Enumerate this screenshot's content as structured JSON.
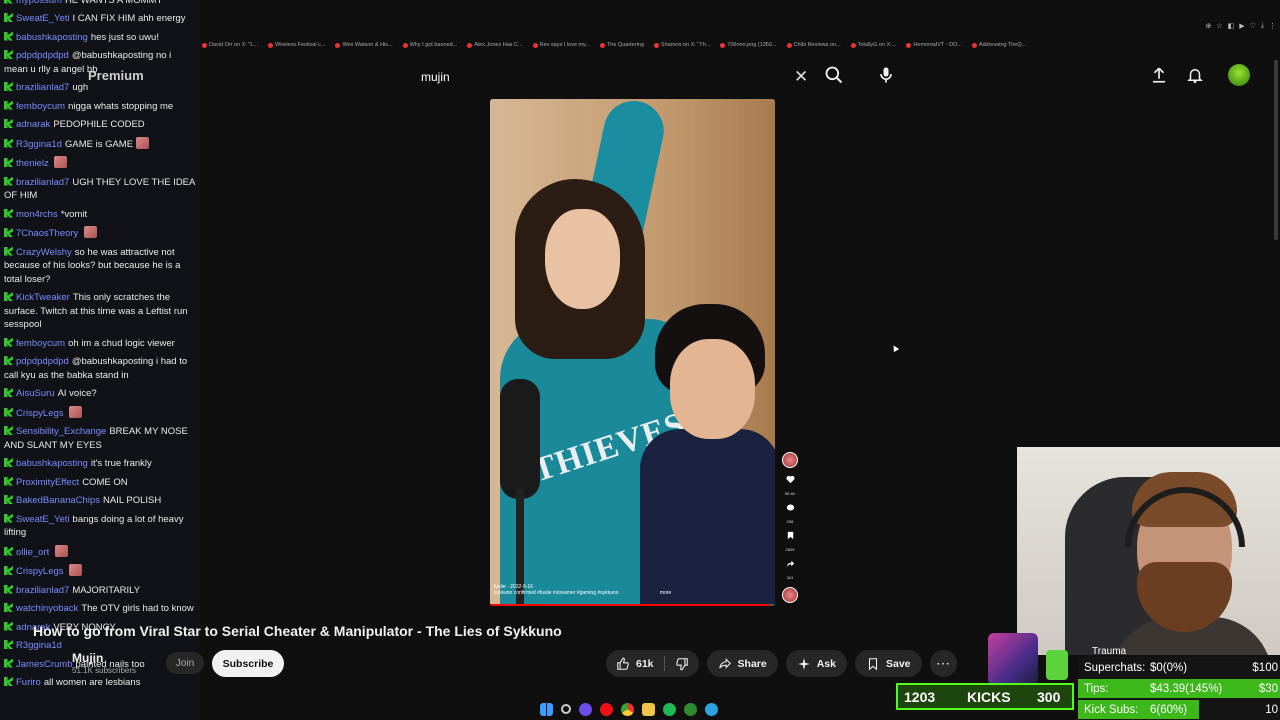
{
  "chat": {
    "messages": [
      {
        "user": "mypossum",
        "text": "HE WANTS A MOMMY"
      },
      {
        "user": "SweatE_Yeti",
        "text": "I CAN FIX HIM ahh energy"
      },
      {
        "user": "babushkaposting",
        "text": "hes just so uwu!"
      },
      {
        "user": "pdpdpdpdpd",
        "text": "@babushkaposting no i mean u rlly a angel bb"
      },
      {
        "user": "brazilianlad7",
        "text": "ugh"
      },
      {
        "user": "femboycum",
        "text": "nigga whats stopping me"
      },
      {
        "user": "adnarak",
        "text": "PEDOPHILE CODED"
      },
      {
        "user": "R3ggina1d",
        "text": "GAME is GAME",
        "emote": true
      },
      {
        "user": "thenielz",
        "text": "",
        "emote": true
      },
      {
        "user": "brazilianlad7",
        "text": "UGH THEY LOVE THE IDEA OF HIM"
      },
      {
        "user": "mon4rchs",
        "text": "*vomit"
      },
      {
        "user": "7ChaosTheory",
        "text": "",
        "emote": true
      },
      {
        "user": "CrazyWelshy",
        "text": "so he was attractive not because of his looks? but because he is a total loser?"
      },
      {
        "user": "KickTweaker",
        "text": "This only scratches the surface. Twitch at this time was a Leftist run sesspool"
      },
      {
        "user": "femboycum",
        "text": "oh im a chud logic viewer"
      },
      {
        "user": "pdpdpdpdpd",
        "text": "@babushkaposting i had to call kyu as the babka stand in"
      },
      {
        "user": "AisuSuru",
        "text": "AI voice?"
      },
      {
        "user": "CrispyLegs",
        "text": "",
        "emote": true
      },
      {
        "user": "Sensibility_Exchange",
        "text": "BREAK MY NOSE AND SLANT MY EYES"
      },
      {
        "user": "babushkaposting",
        "text": "it's true frankly"
      },
      {
        "user": "ProximityEffect",
        "text": "COME ON"
      },
      {
        "user": "BakedBananaChips",
        "text": "NAIL POLISH"
      },
      {
        "user": "SweatE_Yeti",
        "text": "bangs doing a lot of heavy lifting"
      },
      {
        "user": "ollie_ort",
        "text": "",
        "emote": true
      },
      {
        "user": "CrispyLegs",
        "text": "",
        "emote": true
      },
      {
        "user": "brazilianlad7",
        "text": "MAJORITARILY"
      },
      {
        "user": "watchinyoback",
        "text": "The OTV girls had to know"
      },
      {
        "user": "adnarak",
        "text": "VERY NONCY"
      },
      {
        "user": "R3ggina1d",
        "text": ""
      },
      {
        "user": "JamesCrumb",
        "text": "painted nails too"
      },
      {
        "user": "Furiro",
        "text": "all women are lesbians"
      }
    ]
  },
  "browser": {
    "bookmarks": [
      "David Orr on X: \"L...",
      "Wireless Festival c...",
      "Wes Watson & His...",
      "Why I got banned...",
      "Alex Jones Has C...",
      "Rev says I love my...",
      "The Quartering",
      "Shamoo on X: \"Th...",
      "706nnn.png (1350...",
      "Chibi Reviews on...",
      "TotallyG on X:...",
      "HemomaIVT - DO...",
      "Addressing TheQ..."
    ]
  },
  "youtube": {
    "premium_label": "Premium",
    "search": {
      "query": "mujin"
    },
    "video": {
      "title": "How to go from Viral Star to Serial Cheater & Manipulator - The Lies of Sykkuno",
      "caption_user": "fuslie",
      "caption_date": "2022-9-16",
      "caption_text": "sykkuno confirmed #fuslie #streamer #gaming #sykkuno",
      "caption_more": "more",
      "hoodie_text": "THIEVES",
      "progress": 0.98
    },
    "channel": {
      "name": "Mujin",
      "subscribers": "51.1K subscribers"
    },
    "join_label": "Join",
    "subscribe_label": "Subscribe",
    "likes": "61k",
    "share_label": "Share",
    "ask_label": "Ask",
    "save_label": "Save",
    "side_stats": [
      "95.4K",
      "258",
      "2829",
      "341"
    ]
  },
  "overlay": {
    "kicks": {
      "count": "1203",
      "label": "KICKS",
      "goal": "300",
      "progress": 1.0
    },
    "trauma_label": "Trauma",
    "goals": [
      {
        "label": "Superchats:",
        "value": "$0(0%)",
        "target": "$100",
        "progress": 0.0,
        "color": "#2a2a2a"
      },
      {
        "label": "Tips:",
        "value": "$43.39(145%)",
        "target": "$30",
        "progress": 1.0,
        "color": "#3cb81a"
      },
      {
        "label": "Kick Subs:",
        "value": "6(60%)",
        "target": "10",
        "progress": 0.6,
        "color": "#3cb81a"
      }
    ]
  },
  "colors": {
    "accent": "#ff0000",
    "kick_green": "#53fc18",
    "chat_user": "#7a8cff"
  }
}
